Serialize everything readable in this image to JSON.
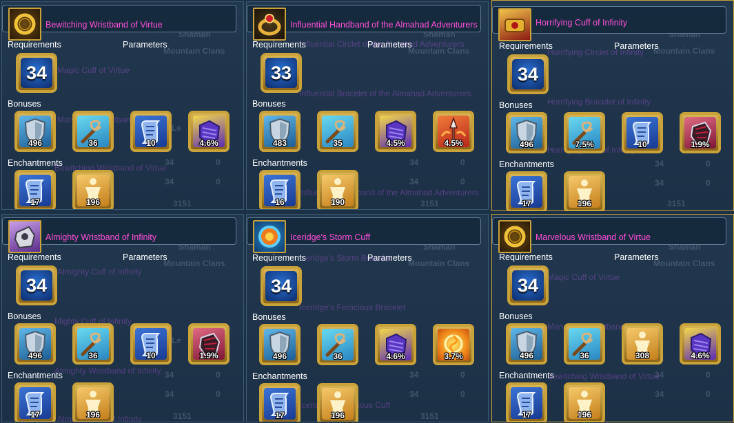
{
  "labels": {
    "requirements": "Requirements",
    "parameters": "Parameters",
    "bonuses": "Bonuses",
    "enchantments": "Enchantments"
  },
  "background_text": {
    "shaman": "Shaman",
    "mountain_clans": "Mountain Clans",
    "stat_34": "34",
    "stat_0": "0",
    "stat_3151": "3151",
    "le": "Le"
  },
  "panels": [
    {
      "item_name": "Bewitching Wristband of Virtue",
      "icon": "gold-chain-bracelet-icon",
      "level": "34",
      "ghost_lines": [
        "Magic Cuff of Virtue",
        "Marvelous Wristband",
        "Bewitching Wristband of Virtue"
      ],
      "bonuses": [
        {
          "icon": "shield-icon",
          "value": "496"
        },
        {
          "icon": "whip-icon",
          "value": "36"
        },
        {
          "icon": "scroll-icon",
          "value": "10"
        },
        {
          "icon": "armor-icon",
          "value": "4.6%"
        }
      ],
      "enchantments": [
        {
          "icon": "scroll-icon",
          "value": "17"
        },
        {
          "icon": "body-icon",
          "value": "196"
        }
      ]
    },
    {
      "item_name": "Influential Handband of the Almahad Adventurers",
      "icon": "ruby-ring-icon",
      "level": "33",
      "ghost_lines": [
        "Influential Circlet of the Almahad Adventurers",
        "Influential Bracelet of the Almahad Adventurers",
        "Influential Handband of the Almahad Adventurers"
      ],
      "bonuses": [
        {
          "icon": "shield-icon",
          "value": "483"
        },
        {
          "icon": "whip-icon",
          "value": "35"
        },
        {
          "icon": "armor-icon",
          "value": "4.5%"
        },
        {
          "icon": "spear-icon",
          "value": "4.5%"
        }
      ],
      "enchantments": [
        {
          "icon": "scroll-icon",
          "value": "16"
        },
        {
          "icon": "body-icon",
          "value": "190"
        }
      ]
    },
    {
      "item_name": "Horrifying Cuff of Infinity",
      "icon": "gold-cuff-icon",
      "level": "34",
      "ghost_lines": [
        "Horrifying Circlet of Infinity",
        "Horrifying Bracelet of Infinity",
        "Horrifying Cuff of Infinity"
      ],
      "bonuses": [
        {
          "icon": "shield-icon",
          "value": "496"
        },
        {
          "icon": "whip-icon",
          "value": "7.5%"
        },
        {
          "icon": "scroll-icon",
          "value": "10"
        },
        {
          "icon": "gauntlet-icon",
          "value": "1.9%"
        }
      ],
      "enchantments": [
        {
          "icon": "scroll-icon",
          "value": "17"
        },
        {
          "icon": "body-icon",
          "value": "196"
        }
      ]
    },
    {
      "item_name": "Almighty Wristband of Infinity",
      "icon": "silver-skull-bracer-icon",
      "level": "34",
      "ghost_lines": [
        "Almighty Cuff of Infinity",
        "Mighty Cuff of Infinity",
        "Almighty Wristband of Infinity",
        "Almighty Cuff of Infinity"
      ],
      "bonuses": [
        {
          "icon": "shield-icon",
          "value": "496"
        },
        {
          "icon": "whip-icon",
          "value": "36"
        },
        {
          "icon": "scroll-icon",
          "value": "10"
        },
        {
          "icon": "gauntlet-icon",
          "value": "1.9%"
        }
      ],
      "enchantments": [
        {
          "icon": "scroll-icon",
          "value": "17"
        },
        {
          "icon": "body-icon",
          "value": "196"
        }
      ]
    },
    {
      "item_name": "Iceridge's Storm Cuff",
      "icon": "orange-orb-bracelet-icon",
      "level": "34",
      "ghost_lines": [
        "Iceridge's Storm Bracelet",
        "Iceridge's Ferocious Bracelet",
        "Iceridge's Storm Cuff",
        "Iceridge's Ferocious Cuff"
      ],
      "bonuses": [
        {
          "icon": "shield-icon",
          "value": "496"
        },
        {
          "icon": "whip-icon",
          "value": "36"
        },
        {
          "icon": "armor-icon",
          "value": "4.6%"
        },
        {
          "icon": "fire-icon",
          "value": "3.7%"
        }
      ],
      "enchantments": [
        {
          "icon": "scroll-icon",
          "value": "17"
        },
        {
          "icon": "body-icon",
          "value": "196"
        }
      ]
    },
    {
      "item_name": "Marvelous Wristband of Virtue",
      "icon": "gold-chain-bracelet-icon",
      "level": "34",
      "ghost_lines": [
        "Magic Cuff of Virtue",
        "Marvelous Wristband",
        "Bewitching Wristband of Virtue"
      ],
      "bonuses": [
        {
          "icon": "shield-icon",
          "value": "496"
        },
        {
          "icon": "whip-icon",
          "value": "36"
        },
        {
          "icon": "body-icon",
          "value": "308"
        },
        {
          "icon": "armor-icon",
          "value": "4.6%"
        }
      ],
      "enchantments": [
        {
          "icon": "scroll-icon",
          "value": "17"
        },
        {
          "icon": "body-icon",
          "value": "196"
        }
      ]
    }
  ]
}
